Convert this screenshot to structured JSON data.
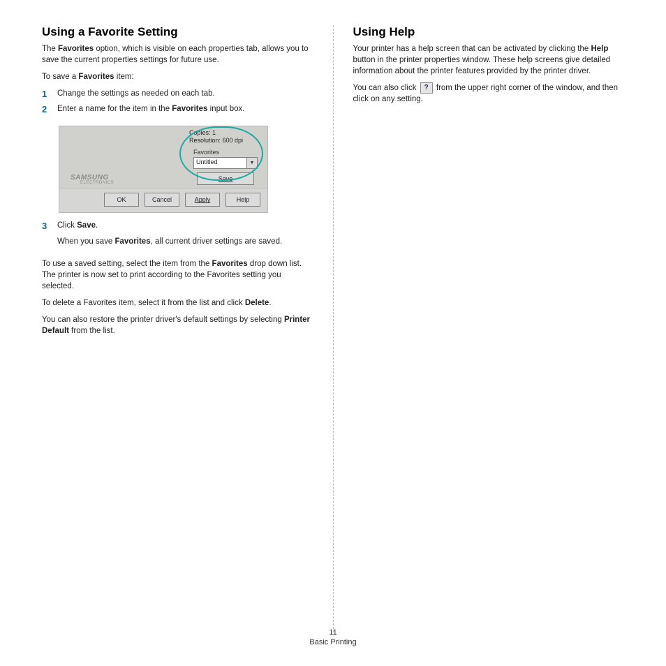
{
  "left": {
    "heading": "Using a Favorite Setting",
    "intro": {
      "pre": "The ",
      "b1": "Favorites",
      "post": " option, which is visible on each properties tab, allows you to save the current properties settings for future use."
    },
    "toSave": {
      "pre": "To save a ",
      "b1": "Favorites",
      "post": " item:"
    },
    "steps12": [
      {
        "n": "1",
        "text": "Change the settings as needed on each tab."
      },
      {
        "n": "2",
        "pre": "Enter a name for the item in the ",
        "b1": "Favorites",
        "post": " input box."
      }
    ],
    "step3": {
      "n": "3",
      "line1": {
        "pre": "Click ",
        "b1": "Save",
        "post": "."
      },
      "line2": {
        "pre": "When you save ",
        "b1": "Favorites",
        "post": ", all current driver settings are saved."
      }
    },
    "toUse": {
      "pre": "To use a saved setting, select the item from the ",
      "b1": "Favorites",
      "post": " drop down list. The printer is now set to print according to the Favorites setting you selected."
    },
    "toDelete": {
      "pre": "To delete a Favorites item, select it from the list and click ",
      "b1": "Delete",
      "post": "."
    },
    "restore": {
      "pre": "You can also restore the printer driver's default settings by selecting ",
      "b1": "Printer Default",
      "post": " from the list."
    }
  },
  "right": {
    "heading": "Using Help",
    "p1": {
      "pre": "Your printer has a help screen that can be activated by clicking the ",
      "b1": "Help",
      "post": " button in the printer properties window. These help screens give detailed information about the printer features provided by the printer driver."
    },
    "p2a": "You can also click ",
    "p2b": " from the upper right corner of the window, and then click on any setting.",
    "helpGlyph": "?"
  },
  "dialog": {
    "copies": "Copies: 1",
    "resolution": "Resolution: 600 dpi",
    "favLabel": "Favorites",
    "comboValue": "Untitled",
    "saveBtn": "Save",
    "brand1": "SAMSUNG",
    "brand2": "ELECTRONICS",
    "buttons": {
      "ok": "OK",
      "cancel": "Cancel",
      "apply": "Apply",
      "help": "Help"
    }
  },
  "footer": {
    "page": "11",
    "section": "Basic Printing"
  }
}
